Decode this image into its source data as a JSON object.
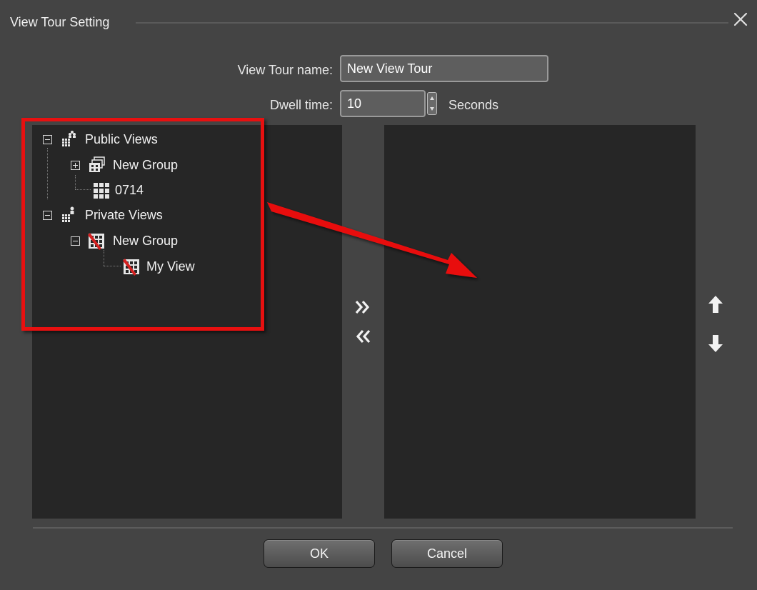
{
  "window": {
    "title": "View Tour Setting",
    "close_icon": "close-icon"
  },
  "form": {
    "name_label": "View Tour name:",
    "name_value": "New View Tour",
    "dwell_label": "Dwell time:",
    "dwell_value": "10",
    "dwell_unit": "Seconds"
  },
  "tree": {
    "public_views": {
      "label": "Public Views",
      "expander": "minus",
      "icon": "public-views-icon"
    },
    "public_group": {
      "label": "New Group",
      "expander": "plus",
      "icon": "public-group-icon"
    },
    "public_view_0714": {
      "label": "0714",
      "icon": "grid-view-icon"
    },
    "private_views": {
      "label": "Private Views",
      "expander": "minus",
      "icon": "private-views-icon"
    },
    "private_group": {
      "label": "New Group",
      "expander": "minus",
      "icon": "private-group-icon"
    },
    "private_view_my": {
      "label": "My View",
      "icon": "private-view-icon"
    }
  },
  "controls": {
    "add_icon": "double-chevron-right-icon",
    "remove_icon": "double-chevron-left-icon",
    "move_up_icon": "arrow-up-icon",
    "move_down_icon": "arrow-down-icon"
  },
  "buttons": {
    "ok": "OK",
    "cancel": "Cancel"
  },
  "annotation": {
    "highlight_color": "#e81010",
    "arrow_color": "#e81010"
  },
  "colors": {
    "dialog_bg": "#444444",
    "panel_bg": "#262626",
    "text": "#f2f2f2"
  }
}
